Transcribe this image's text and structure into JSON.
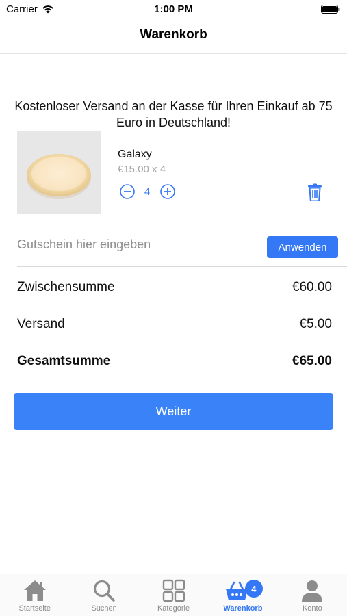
{
  "status_bar": {
    "carrier": "Carrier",
    "time": "1:00 PM"
  },
  "nav": {
    "title": "Warenkorb"
  },
  "banner": {
    "text": "Kostenloser Versand an der Kasse für Ihren Einkauf ab 75 Euro in Deutschland!"
  },
  "cart_item": {
    "name": "Galaxy",
    "price_line": "€15.00 x 4",
    "quantity": "4"
  },
  "coupon": {
    "placeholder": "Gutschein hier eingeben",
    "apply_label": "Anwenden"
  },
  "totals": {
    "subtotal_label": "Zwischensumme",
    "subtotal_value": "€60.00",
    "shipping_label": "Versand",
    "shipping_value": "€5.00",
    "total_label": "Gesamtsumme",
    "total_value": "€65.00"
  },
  "continue_label": "Weiter",
  "tabs": [
    {
      "label": "Startseite",
      "icon": "home-icon"
    },
    {
      "label": "Suchen",
      "icon": "search-icon"
    },
    {
      "label": "Kategorie",
      "icon": "grid-icon"
    },
    {
      "label": "Warenkorb",
      "icon": "basket-icon",
      "badge": "4",
      "active": true
    },
    {
      "label": "Konto",
      "icon": "person-icon"
    }
  ],
  "colors": {
    "accent": "#3478f6",
    "tab_inactive": "#8c8c8c"
  }
}
